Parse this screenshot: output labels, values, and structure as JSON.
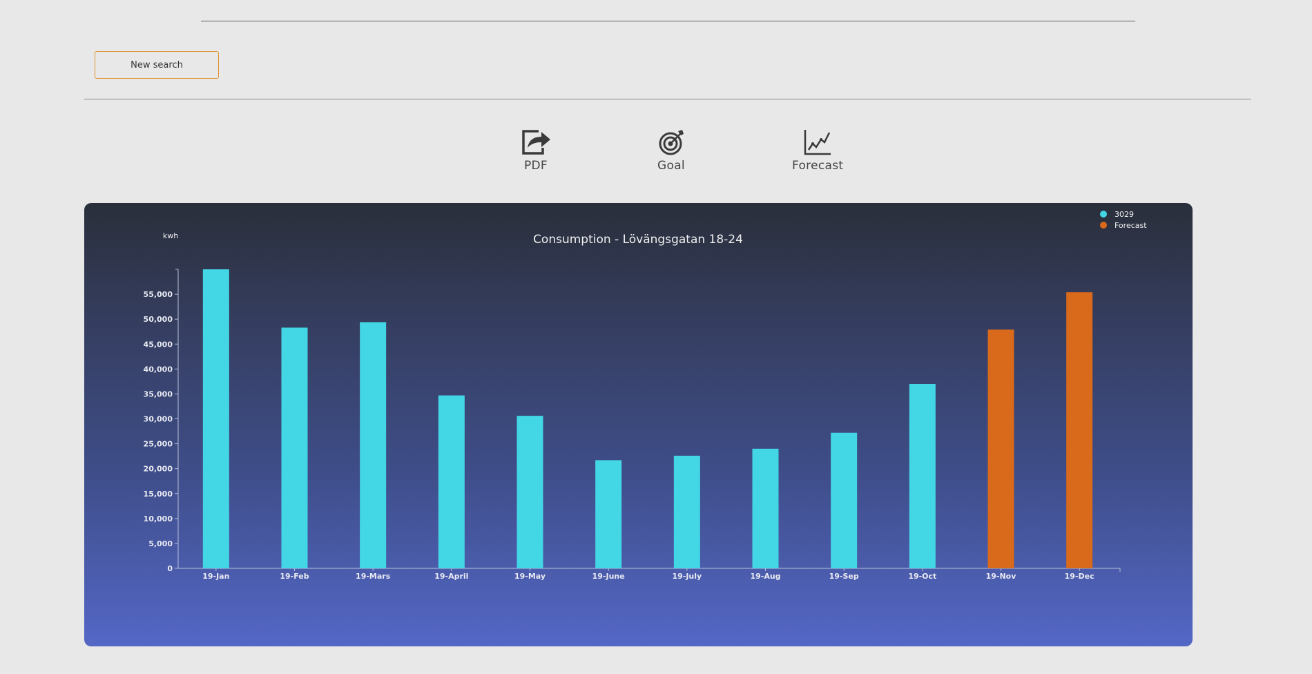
{
  "toolbar": {
    "new_search_label": "New search",
    "actions": [
      {
        "label": "PDF",
        "icon": "pdf-export-icon"
      },
      {
        "label": "Goal",
        "icon": "target-icon"
      },
      {
        "label": "Forecast",
        "icon": "trend-chart-icon"
      }
    ]
  },
  "colors": {
    "accent_border": "#e0922f",
    "series_actual": "#43d7e6",
    "series_forecast": "#d9691b"
  },
  "chart_data": {
    "type": "bar",
    "title": "Consumption - Lövängsgatan 18-24",
    "ylabel": "kwh",
    "xlabel": "",
    "ylim": [
      0,
      60000
    ],
    "yticks": [
      0,
      5000,
      10000,
      15000,
      20000,
      25000,
      30000,
      35000,
      40000,
      45000,
      50000,
      55000
    ],
    "ytick_labels": [
      "0",
      "5,000",
      "10,000",
      "15,000",
      "20,000",
      "25,000",
      "30,000",
      "35,000",
      "40,000",
      "45,000",
      "50,000",
      "55,000"
    ],
    "categories": [
      "19-Jan",
      "19-Feb",
      "19-Mars",
      "19-April",
      "19-May",
      "19-June",
      "19-July",
      "19-Aug",
      "19-Sep",
      "19-Oct",
      "19-Nov",
      "19-Dec"
    ],
    "series": [
      {
        "name": "3029",
        "color": "#43d7e6",
        "values": [
          60000,
          48300,
          49400,
          34700,
          30600,
          21700,
          22600,
          24000,
          27200,
          37000,
          null,
          null
        ]
      },
      {
        "name": "Forecast",
        "color": "#d9691b",
        "values": [
          null,
          null,
          null,
          null,
          null,
          null,
          null,
          null,
          null,
          null,
          47900,
          55400
        ]
      }
    ],
    "legend": "top-right",
    "grid": false
  }
}
